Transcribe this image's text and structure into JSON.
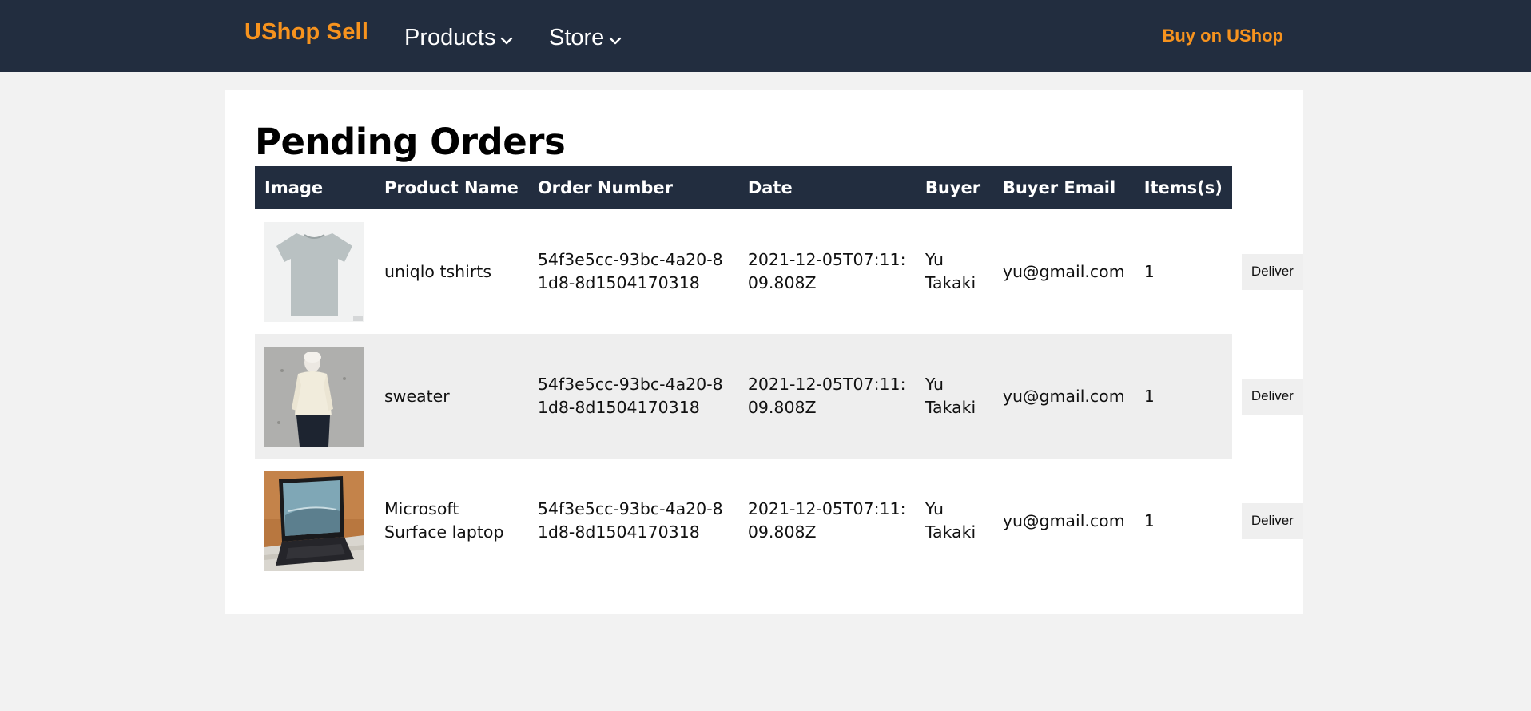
{
  "nav": {
    "brand": "UShop Sell",
    "products_label": "Products",
    "store_label": "Store",
    "buy_link": "Buy on UShop",
    "brand_color": "#f7931e",
    "bar_color": "#222d3f"
  },
  "page": {
    "title": "Pending Orders"
  },
  "table": {
    "headers": [
      "Image",
      "Product Name",
      "Order Number",
      "Date",
      "Buyer",
      "Buyer Email",
      "Items(s)"
    ],
    "rows": [
      {
        "image_icon": "tshirt-photo",
        "product_name": "uniqlo tshirts",
        "order_number": "54f3e5cc-93bc-4a20-81d8-8d1504170318",
        "date": "2021-12-05T07:11:09.808Z",
        "buyer": "Yu Takaki",
        "buyer_email": "yu@gmail.com",
        "items": "1",
        "action": "Deliver"
      },
      {
        "image_icon": "sweater-photo",
        "product_name": "sweater",
        "order_number": "54f3e5cc-93bc-4a20-81d8-8d1504170318",
        "date": "2021-12-05T07:11:09.808Z",
        "buyer": "Yu Takaki",
        "buyer_email": "yu@gmail.com",
        "items": "1",
        "action": "Deliver"
      },
      {
        "image_icon": "laptop-photo",
        "product_name": "Microsoft Surface laptop",
        "order_number": "54f3e5cc-93bc-4a20-81d8-8d1504170318",
        "date": "2021-12-05T07:11:09.808Z",
        "buyer": "Yu Takaki",
        "buyer_email": "yu@gmail.com",
        "items": "1",
        "action": "Deliver"
      }
    ]
  }
}
